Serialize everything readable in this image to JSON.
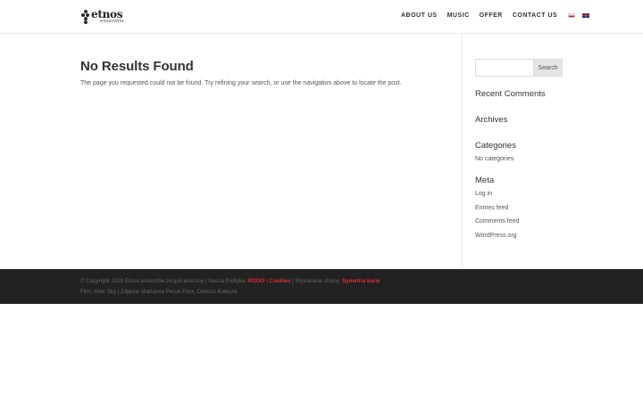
{
  "header": {
    "logo": {
      "word": "etnos",
      "sub": "ensemble"
    },
    "nav": [
      "ABOUT US",
      "MUSIC",
      "OFFER",
      "CONTACT US"
    ],
    "flags": [
      "flag-pl-icon",
      "flag-en-icon"
    ]
  },
  "main": {
    "title": "No Results Found",
    "text": "The page you requested could not be found. Try refining your search, or use the navigation above to locate the post."
  },
  "sidebar": {
    "search": {
      "placeholder": "",
      "button": "Search"
    },
    "recent_comments": "Recent Comments",
    "archives": "Archives",
    "categories": {
      "title": "Categories",
      "empty": "No categories"
    },
    "meta": {
      "title": "Meta",
      "items": [
        "Log in",
        "Entries feed",
        "Comments feed",
        "WordPress.org"
      ]
    }
  },
  "footer": {
    "line1_prefix": "© Copyright 2020 Etnos ensemble zespół etniczny | Nasza Polityka: ",
    "link_rodo": "RODO i Cookies",
    "line1_mid": " | Wykonanie strony: ",
    "link_symetria": "Symetria barw",
    "line2": "Film: After Sky | Zdjęcia: Marianna Peruń-Filux, Dariusz Kulesza"
  },
  "colors": {
    "footer_bg": "#222222",
    "footer_link": "#d92b35",
    "title": "#333333",
    "body_text": "#555555"
  }
}
